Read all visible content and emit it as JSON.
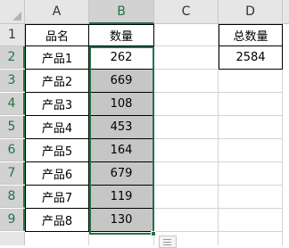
{
  "spreadsheet": {
    "columns": [
      "A",
      "B",
      "C",
      "D"
    ],
    "rows": [
      "1",
      "2",
      "3",
      "4",
      "5",
      "6",
      "7",
      "8",
      "9"
    ],
    "header_row": {
      "A1": "品名",
      "B1": "数量",
      "D1": "总数量"
    },
    "products": [
      {
        "name": "产品1",
        "qty": "262"
      },
      {
        "name": "产品2",
        "qty": "669"
      },
      {
        "name": "产品3",
        "qty": "108"
      },
      {
        "name": "产品4",
        "qty": "453"
      },
      {
        "name": "产品5",
        "qty": "164"
      },
      {
        "name": "产品6",
        "qty": "679"
      },
      {
        "name": "产品7",
        "qty": "119"
      },
      {
        "name": "产品8",
        "qty": "130"
      }
    ],
    "D2": "2584",
    "selected_range": "B2:B9",
    "accent_color": "#217346",
    "selection_fill": "#c6c6c6"
  },
  "icons": {
    "select_all": "select-all-triangle-icon",
    "quick_analysis": "quick-analysis-icon"
  }
}
